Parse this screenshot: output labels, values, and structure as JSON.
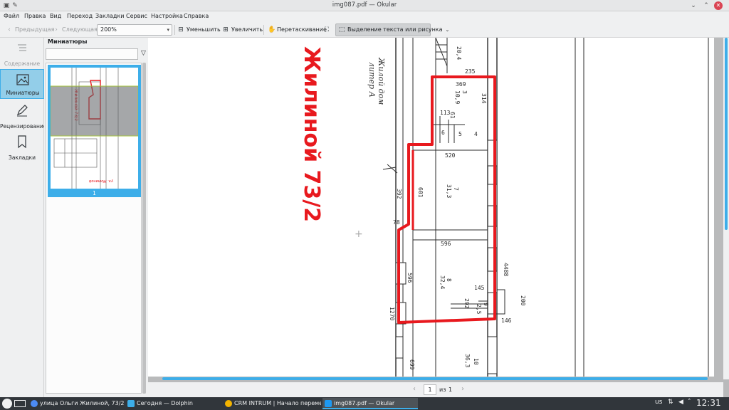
{
  "window": {
    "title": "img087.pdf — Okular"
  },
  "menu": [
    "Файл",
    "Правка",
    "Вид",
    "Переход",
    "Закладки",
    "Сервис",
    "Настройка",
    "Справка"
  ],
  "toolbar": {
    "prev": "Предыдущая",
    "next": "Следующая",
    "zoom_value": "200%",
    "zoom_out": "Уменьшить",
    "zoom_in": "Увеличить",
    "browse": "Перетаскивание",
    "select": "Выделение текста или рисунка"
  },
  "sidebar": [
    {
      "label": "Содержание",
      "icon": "contents-icon",
      "enabled": false
    },
    {
      "label": "Миниатюры",
      "icon": "thumbnails-icon",
      "active": true
    },
    {
      "label": "Рецензирование",
      "icon": "review-icon"
    },
    {
      "label": "Закладки",
      "icon": "bookmarks-icon"
    }
  ],
  "thumbnails": {
    "title": "Миниатюры",
    "search_value": "",
    "page_label": "1"
  },
  "document": {
    "handwriting": "Жилиной 73/2",
    "printed_label": [
      "Жилой дом",
      "литер А"
    ],
    "dims": [
      "20,4",
      "235",
      "369",
      "314",
      "3",
      "10,9",
      "113",
      "61",
      "4",
      "5",
      "6",
      "520",
      "601",
      "7",
      "31,3",
      "392",
      "78",
      "596",
      "596",
      "8",
      "32,4",
      "145",
      "9",
      "2,5",
      "292",
      "200",
      "1270",
      "146",
      "4488",
      "10",
      "36,3",
      "699"
    ]
  },
  "pagebar": {
    "current": "1",
    "of": "из",
    "total": "1"
  },
  "taskbar": {
    "tasks": [
      {
        "label": "улица Ольги Жилиной, 73/2 — 2...",
        "icon": "chrome-icon"
      },
      {
        "label": "Сегодня — Dolphin",
        "icon": "folder-icon"
      },
      {
        "label": "CRM INTRUM | Начало перемен, ...",
        "icon": "chrome-icon"
      },
      {
        "label": "img087.pdf — Okular",
        "icon": "okular-icon",
        "active": true
      }
    ],
    "layout": "us",
    "clock": "12:31"
  },
  "colors": {
    "accent": "#3daee9",
    "red_outline": "#e8191e",
    "taskbar": "#31363b"
  }
}
